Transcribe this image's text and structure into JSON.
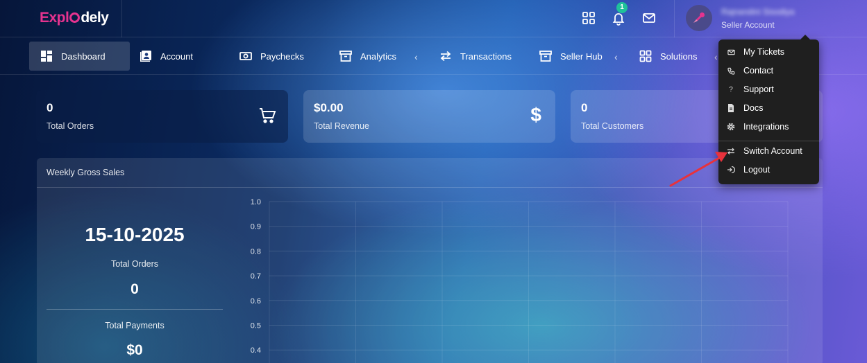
{
  "brand": {
    "logo_part1": "Expl",
    "logo_part2": "dely"
  },
  "topbar": {
    "notification_count": "1",
    "user_name": "Rajnandini Sisodiya",
    "user_role": "Seller Account"
  },
  "nav": {
    "items": [
      {
        "label": "Dashboard",
        "icon": "dashboard-icon"
      },
      {
        "label": "Account",
        "icon": "account-icon"
      },
      {
        "label": "Paychecks",
        "icon": "paychecks-icon"
      },
      {
        "label": "Analytics",
        "icon": "analytics-icon"
      },
      {
        "label": "Transactions",
        "icon": "transactions-icon"
      },
      {
        "label": "Seller Hub",
        "icon": "seller-hub-icon"
      },
      {
        "label": "Solutions",
        "icon": "solutions-icon"
      }
    ]
  },
  "stats": [
    {
      "value": "0",
      "label": "Total Orders",
      "icon": "cart-icon"
    },
    {
      "value": "$0.00",
      "label": "Total Revenue",
      "icon": "dollar-icon"
    },
    {
      "value": "0",
      "label": "Total Customers",
      "icon": "customers-icon"
    }
  ],
  "weekly": {
    "title": "Weekly Gross Sales",
    "date": "15-10-2025",
    "orders_label": "Total Orders",
    "orders_value": "0",
    "payments_label": "Total Payments",
    "payments_value": "$0"
  },
  "chart_data": {
    "type": "line",
    "title": "",
    "xlabel": "",
    "ylabel": "",
    "y_ticks": [
      "1.0",
      "0.9",
      "0.8",
      "0.7",
      "0.6",
      "0.5",
      "0.4"
    ],
    "ylim": [
      0,
      1.0
    ],
    "grid": true,
    "series": []
  },
  "dropdown": {
    "items": [
      {
        "label": "My Tickets",
        "icon": "mail-icon"
      },
      {
        "label": "Contact",
        "icon": "phone-icon"
      },
      {
        "label": "Support",
        "icon": "question-icon"
      },
      {
        "label": "Docs",
        "icon": "document-icon"
      },
      {
        "label": "Integrations",
        "icon": "gear-icon"
      },
      {
        "label": "Switch Account",
        "icon": "switch-icon"
      },
      {
        "label": "Logout",
        "icon": "logout-icon"
      }
    ]
  },
  "colors": {
    "brand_pink": "#e5338f",
    "badge_green": "#1fc29a",
    "annotation_arrow": "#e8323c"
  }
}
